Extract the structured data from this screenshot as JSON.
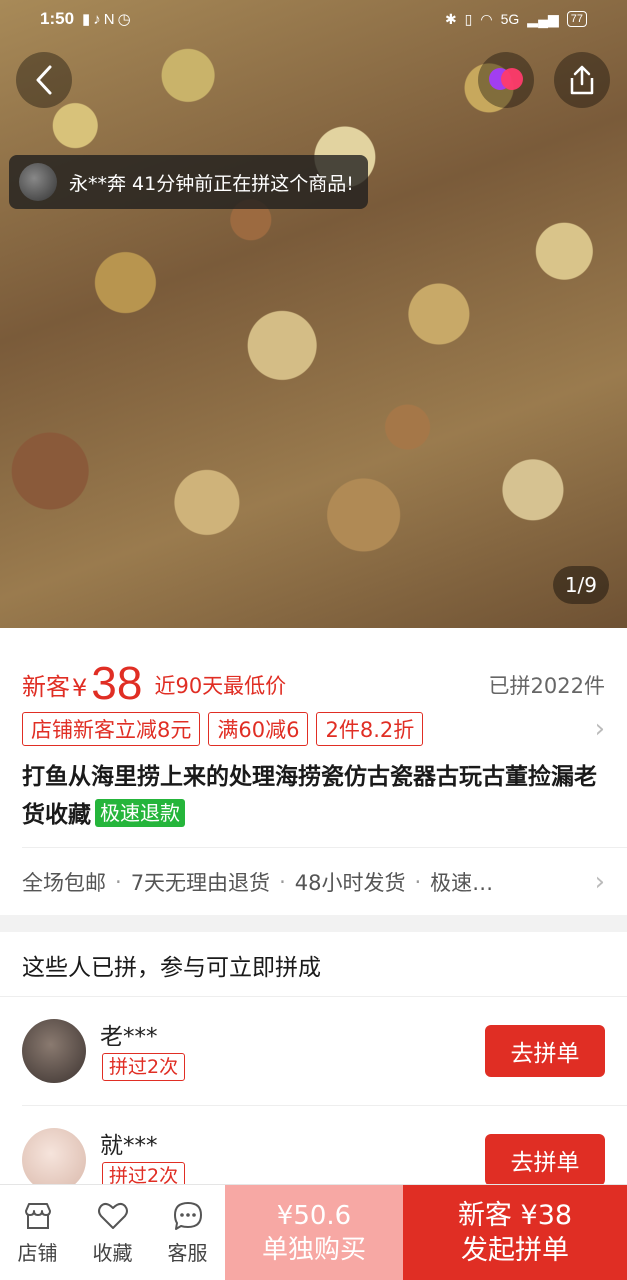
{
  "status_bar": {
    "time": "1:50",
    "battery": "77",
    "network": "5G"
  },
  "hero": {
    "page_counter": "1/9"
  },
  "toast": {
    "text": "永**奔 41分钟前正在拼这个商品!"
  },
  "price_block": {
    "new_customer_label": "新客",
    "currency": "¥",
    "price": "38",
    "lowest_tag": "近90天最低价",
    "sold_text": "已拼2022件"
  },
  "coupons": [
    "店铺新客立减8元",
    "满60减6",
    "2件8.2折"
  ],
  "product": {
    "title": "打鱼从海里捞上来的处理海捞瓷仿古瓷器古玩古董捡漏老货收藏",
    "refund_tag": "极速退款"
  },
  "services": [
    "全场包邮",
    "7天无理由退货",
    "48小时发货",
    "极速…"
  ],
  "group_section": {
    "title": "这些人已拼，参与可立即拼成",
    "rows": [
      {
        "name": "老***",
        "badge": "拼过2次",
        "button": "去拼单"
      },
      {
        "name": "就***",
        "badge": "拼过2次",
        "button": "去拼单"
      }
    ]
  },
  "bottom_bar": {
    "tabs": [
      {
        "label": "店铺",
        "icon": "store-icon"
      },
      {
        "label": "收藏",
        "icon": "heart-icon"
      },
      {
        "label": "客服",
        "icon": "chat-icon"
      }
    ],
    "solo_price": "¥50.6",
    "solo_label": "单独购买",
    "group_price": "新客 ¥38",
    "group_label": "发起拼单"
  },
  "colors": {
    "accent": "#e02e24",
    "refund_green": "#25b53b",
    "solo_bg": "#f7a8a4"
  }
}
